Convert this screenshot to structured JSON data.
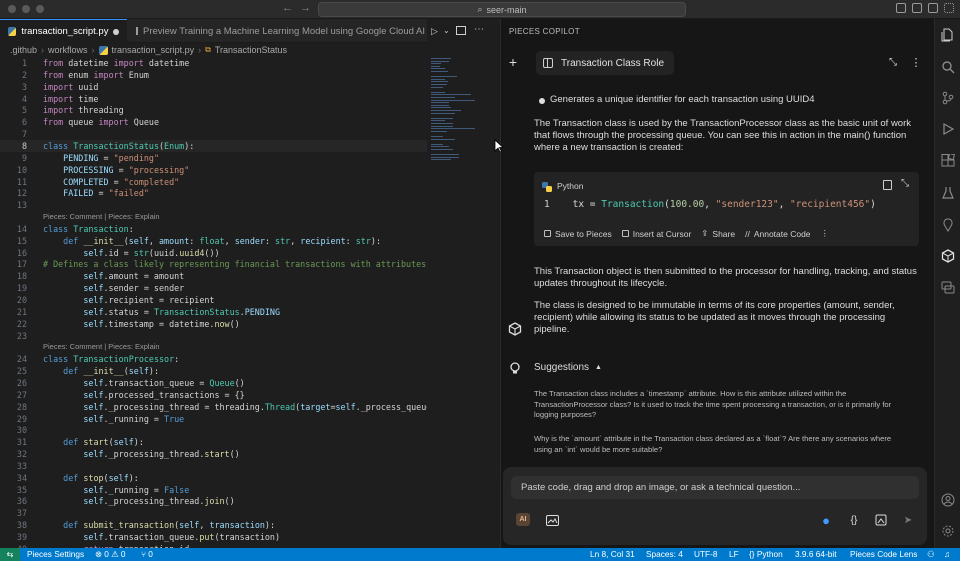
{
  "titlebar": {
    "command_center": "seer-main",
    "back": "←",
    "forward": "→"
  },
  "tabs": [
    {
      "label": "transaction_script.py",
      "active": true
    },
    {
      "label": "Preview Training a Machine Learning Model using Google Cloud AI Plat",
      "active": false
    }
  ],
  "breadcrumb": [
    ".github",
    "workflows",
    "transaction_script.py",
    "TransactionStatus"
  ],
  "editor": {
    "codelens_1": "Pieces: Comment | Pieces: Explain",
    "codelens_2": "Pieces: Comment | Pieces: Explain",
    "lines": [
      {
        "n": "1",
        "html": "<span class='kw2'>from</span> datetime <span class='kw2'>import</span> datetime"
      },
      {
        "n": "2",
        "html": "<span class='kw2'>from</span> enum <span class='kw2'>import</span> Enum"
      },
      {
        "n": "3",
        "html": "<span class='kw2'>import</span> uuid"
      },
      {
        "n": "4",
        "html": "<span class='kw2'>import</span> time"
      },
      {
        "n": "5",
        "html": "<span class='kw2'>import</span> threading"
      },
      {
        "n": "6",
        "html": "<span class='kw2'>from</span> queue <span class='kw2'>import</span> Queue"
      },
      {
        "n": "7",
        "html": ""
      },
      {
        "n": "8",
        "html": "<span class='kw'>class</span> <span class='cls'>TransactionStatus</span>(<span class='cls'>Enum</span>):"
      },
      {
        "n": "9",
        "html": "    <span class='var'>PENDING</span> = <span class='str'>\"pending\"</span>"
      },
      {
        "n": "10",
        "html": "    <span class='var'>PROCESSING</span> = <span class='str'>\"processing\"</span>"
      },
      {
        "n": "11",
        "html": "    <span class='var'>COMPLETED</span> = <span class='str'>\"completed\"</span>"
      },
      {
        "n": "12",
        "html": "    <span class='var'>FAILED</span> = <span class='str'>\"failed\"</span>"
      },
      {
        "n": "13",
        "html": ""
      },
      {
        "n": "14",
        "html": "<span class='kw'>class</span> <span class='cls'>Transaction</span>:"
      },
      {
        "n": "15",
        "html": "    <span class='kw'>def</span> <span class='fn'>__init__</span>(<span class='var'>self</span>, <span class='var'>amount</span>: <span class='cls'>float</span>, <span class='var'>sender</span>: <span class='cls'>str</span>, <span class='var'>recipient</span>: <span class='cls'>str</span>):"
      },
      {
        "n": "16",
        "html": "        <span class='var'>self</span>.id = <span class='cls'>str</span>(uuid.<span class='fn'>uuid4</span>())"
      },
      {
        "n": "17",
        "html": "<span class='cmt'># Defines a class likely representing financial transactions with attributes for</span>"
      },
      {
        "n": "18",
        "html": "        <span class='var'>self</span>.amount = amount"
      },
      {
        "n": "19",
        "html": "        <span class='var'>self</span>.sender = sender"
      },
      {
        "n": "20",
        "html": "        <span class='var'>self</span>.recipient = recipient"
      },
      {
        "n": "21",
        "html": "        <span class='var'>self</span>.status = <span class='cls'>TransactionStatus</span>.<span class='var'>PENDING</span>"
      },
      {
        "n": "22",
        "html": "        <span class='var'>self</span>.timestamp = datetime.<span class='fn'>now</span>()"
      },
      {
        "n": "23",
        "html": ""
      },
      {
        "n": "24",
        "html": "<span class='kw'>class</span> <span class='cls'>TransactionProcessor</span>:"
      },
      {
        "n": "25",
        "html": "    <span class='kw'>def</span> <span class='fn'>__init__</span>(<span class='var'>self</span>):"
      },
      {
        "n": "26",
        "html": "        <span class='var'>self</span>.transaction_queue = <span class='cls'>Queue</span>()"
      },
      {
        "n": "27",
        "html": "        <span class='var'>self</span>.processed_transactions = {}"
      },
      {
        "n": "28",
        "html": "        <span class='var'>self</span>._processing_thread = threading.<span class='cls'>Thread</span>(<span class='var'>target</span>=<span class='var'>self</span>._process_queue)"
      },
      {
        "n": "29",
        "html": "        <span class='var'>self</span>._running = <span class='kw'>True</span>"
      },
      {
        "n": "30",
        "html": ""
      },
      {
        "n": "31",
        "html": "    <span class='kw'>def</span> <span class='fn'>start</span>(<span class='var'>self</span>):"
      },
      {
        "n": "32",
        "html": "        <span class='var'>self</span>._processing_thread.<span class='fn'>start</span>()"
      },
      {
        "n": "33",
        "html": ""
      },
      {
        "n": "34",
        "html": "    <span class='kw'>def</span> <span class='fn'>stop</span>(<span class='var'>self</span>):"
      },
      {
        "n": "35",
        "html": "        <span class='var'>self</span>._running = <span class='kw'>False</span>"
      },
      {
        "n": "36",
        "html": "        <span class='var'>self</span>._processing_thread.<span class='fn'>join</span>()"
      },
      {
        "n": "37",
        "html": ""
      },
      {
        "n": "38",
        "html": "    <span class='kw'>def</span> <span class='fn'>submit_transaction</span>(<span class='var'>self</span>, <span class='var'>transaction</span>):"
      },
      {
        "n": "39",
        "html": "        <span class='var'>self</span>.transaction_queue.<span class='fn'>put</span>(transaction)"
      },
      {
        "n": "40",
        "html": "        <span class='kw2'>return</span> transaction.id"
      }
    ]
  },
  "copilot": {
    "header": "PIECES COPILOT",
    "chat_title": "Transaction Class Role",
    "bullet_text": "Generates a unique identifier for each transaction using UUID4",
    "para1": "The Transaction class is used by the TransactionProcessor class as the basic unit of work that flows through the processing queue. You can see this in action in the main() function where a new transaction is created:",
    "code_lang": "Python",
    "code_line_no": "1",
    "code_actions": [
      "Save to Pieces",
      "Insert at Cursor",
      "Share",
      "Annotate Code"
    ],
    "para2": "This Transaction object is then submitted to the processor for handling, tracking, and status updates throughout its lifecycle.",
    "para3": "The class is designed to be immutable in terms of its core properties (amount, sender, recipient) while allowing its status to be updated as it moves through the processing pipeline.",
    "suggestions_label": "Suggestions",
    "suggestions": [
      "The Transaction class includes a `timestamp` attribute. How is this attribute utilized within the TransactionProcessor class?  Is it used to track the time spent processing a transaction, or is it primarily for logging purposes?",
      "Why is the `amount` attribute in the Transaction class declared as a `float`? Are there any scenarios where using an `int` would be more suitable?"
    ],
    "input_placeholder": "Paste code, drag and drop an image, or ask a technical question...",
    "ai_chip": "AI"
  },
  "statusbar": {
    "pieces_settings": "Pieces Settings",
    "problems": "⊗ 0 ⚠ 0",
    "ports": "⑂ 0",
    "cursor": "Ln 8, Col 31",
    "spaces": "Spaces: 4",
    "encoding": "UTF-8",
    "eol": "LF",
    "language": "{} Python",
    "interpreter": "3.9.6 64-bit",
    "code_lens": "Pieces Code Lens"
  },
  "colors": {
    "accent": "#007acc",
    "status_remote": "#16825d",
    "panel_bg": "#161616"
  }
}
